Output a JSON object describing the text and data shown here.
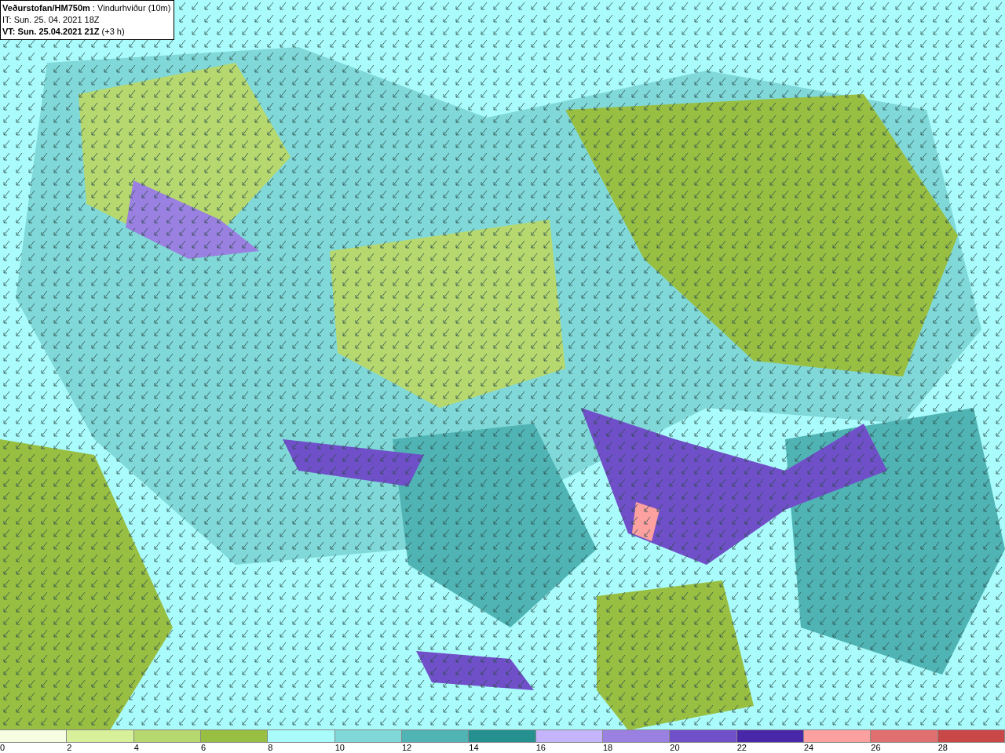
{
  "title_box": {
    "lines": [
      "**Veðurstofan/HM750m** : Vindurhviður (10m)",
      "IT: Sun. 25. 04. 2021 18Z",
      "**VT: Sun. 25.04.2021 21Z** (+3 h)"
    ]
  },
  "legend": {
    "segments": [
      {
        "color": "#f7fde0"
      },
      {
        "color": "#d8f09a"
      },
      {
        "color": "#b6d86e"
      },
      {
        "color": "#98bf42"
      },
      {
        "color": "#aafbfb"
      },
      {
        "color": "#80d8d8"
      },
      {
        "color": "#50b4b4"
      },
      {
        "color": "#249090"
      },
      {
        "color": "#c4b4fc"
      },
      {
        "color": "#9a80e0"
      },
      {
        "color": "#7050c8"
      },
      {
        "color": "#4828a8"
      },
      {
        "color": "#fca0a0"
      },
      {
        "color": "#e07070"
      },
      {
        "color": "#c84848"
      }
    ],
    "ticks": [
      "0",
      "2",
      "4",
      "6",
      "8",
      "10",
      "12",
      "14",
      "16",
      "18",
      "20",
      "22",
      "24",
      "26",
      "28"
    ]
  }
}
